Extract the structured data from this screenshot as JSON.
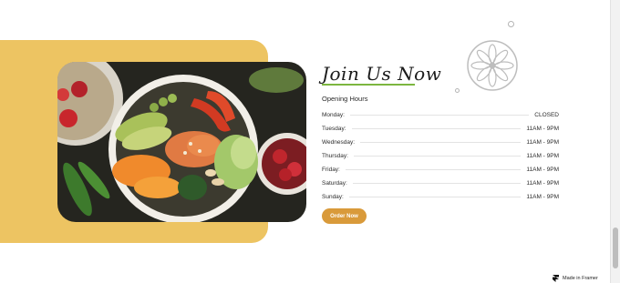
{
  "section": {
    "title": "Join Us Now",
    "hours_heading": "Opening Hours",
    "hours": [
      {
        "day": "Monday:",
        "time": "CLOSED"
      },
      {
        "day": "Tuesday:",
        "time": "11AM - 9PM"
      },
      {
        "day": "Wednesday:",
        "time": "11AM - 9PM"
      },
      {
        "day": "Thursday:",
        "time": "11AM - 9PM"
      },
      {
        "day": "Friday:",
        "time": "11AM - 9PM"
      },
      {
        "day": "Saturday:",
        "time": "11AM - 9PM"
      },
      {
        "day": "Sunday:",
        "time": "11AM - 9PM"
      }
    ],
    "order_button": "Order Now"
  },
  "badge": {
    "label": "Made in Framer",
    "icon": "framer-logo-icon"
  },
  "colors": {
    "panel": "#edc462",
    "accent_green": "#7cb63f",
    "button": "#d99a3a"
  }
}
